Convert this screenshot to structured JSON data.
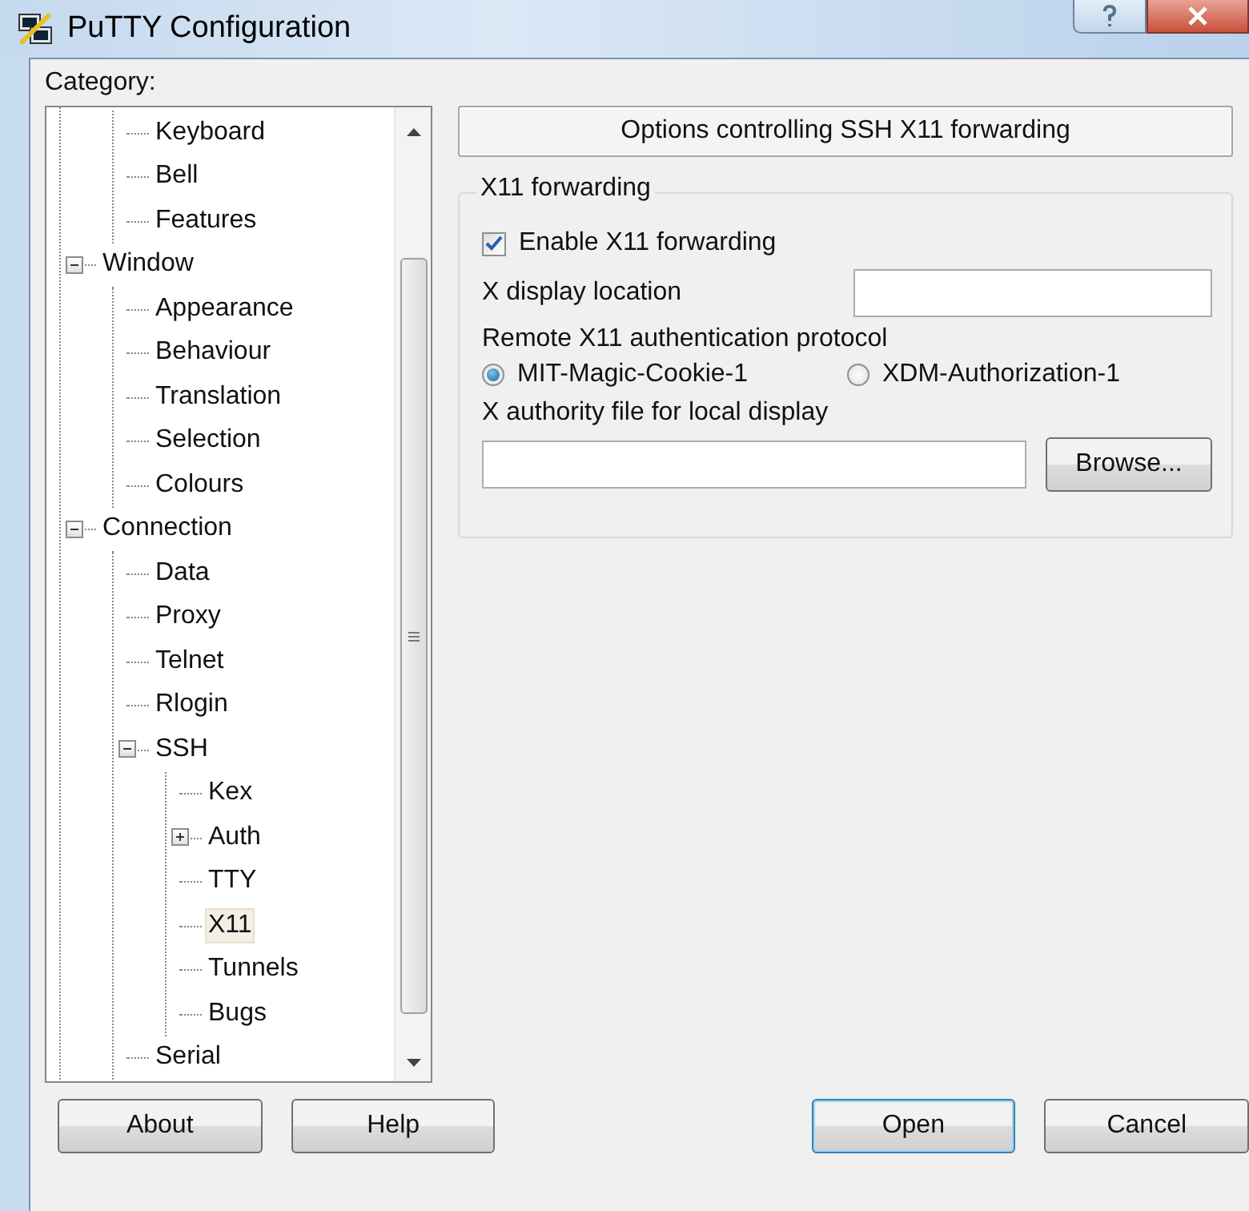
{
  "window": {
    "title": "PuTTY Configuration"
  },
  "category_label": "Category:",
  "tree": {
    "items": [
      {
        "children": [
          {
            "label": "Keyboard",
            "selected": false
          },
          {
            "label": "Bell",
            "selected": false
          },
          {
            "label": "Features",
            "selected": false
          }
        ]
      },
      {
        "label": "Window",
        "selected": false,
        "expanded": true,
        "children": [
          {
            "label": "Appearance",
            "selected": false
          },
          {
            "label": "Behaviour",
            "selected": false
          },
          {
            "label": "Translation",
            "selected": false
          },
          {
            "label": "Selection",
            "selected": false
          },
          {
            "label": "Colours",
            "selected": false
          }
        ]
      },
      {
        "label": "Connection",
        "selected": false,
        "expanded": true,
        "children": [
          {
            "label": "Data",
            "selected": false
          },
          {
            "label": "Proxy",
            "selected": false
          },
          {
            "label": "Telnet",
            "selected": false
          },
          {
            "label": "Rlogin",
            "selected": false
          },
          {
            "label": "SSH",
            "selected": false,
            "expanded": true,
            "children": [
              {
                "label": "Kex",
                "selected": false
              },
              {
                "label": "Auth",
                "selected": false,
                "expanded": false
              },
              {
                "label": "TTY",
                "selected": false
              },
              {
                "label": "X11",
                "selected": true
              },
              {
                "label": "Tunnels",
                "selected": false
              },
              {
                "label": "Bugs",
                "selected": false
              }
            ]
          },
          {
            "label": "Serial",
            "selected": false
          }
        ]
      }
    ]
  },
  "panel": {
    "header": "Options controlling SSH X11 forwarding",
    "group": {
      "title": "X11 forwarding",
      "enable": {
        "label": "Enable X11 forwarding",
        "checked": true
      },
      "display_location": {
        "label": "X display location"
      },
      "protocol": {
        "label": "Remote X11 authentication protocol",
        "options": [
          {
            "label": "MIT-Magic-Cookie-1",
            "selected": true
          },
          {
            "label": "XDM-Authorization-1",
            "selected": false
          }
        ]
      },
      "authority_file": {
        "label": "X authority file for local display",
        "button": "Browse..."
      }
    }
  },
  "left_buttons": [
    {
      "label": "About",
      "default": false
    },
    {
      "label": "Help",
      "default": false
    }
  ],
  "right_buttons": [
    {
      "label": "Open",
      "default": true
    },
    {
      "label": "Cancel",
      "default": false
    }
  ]
}
